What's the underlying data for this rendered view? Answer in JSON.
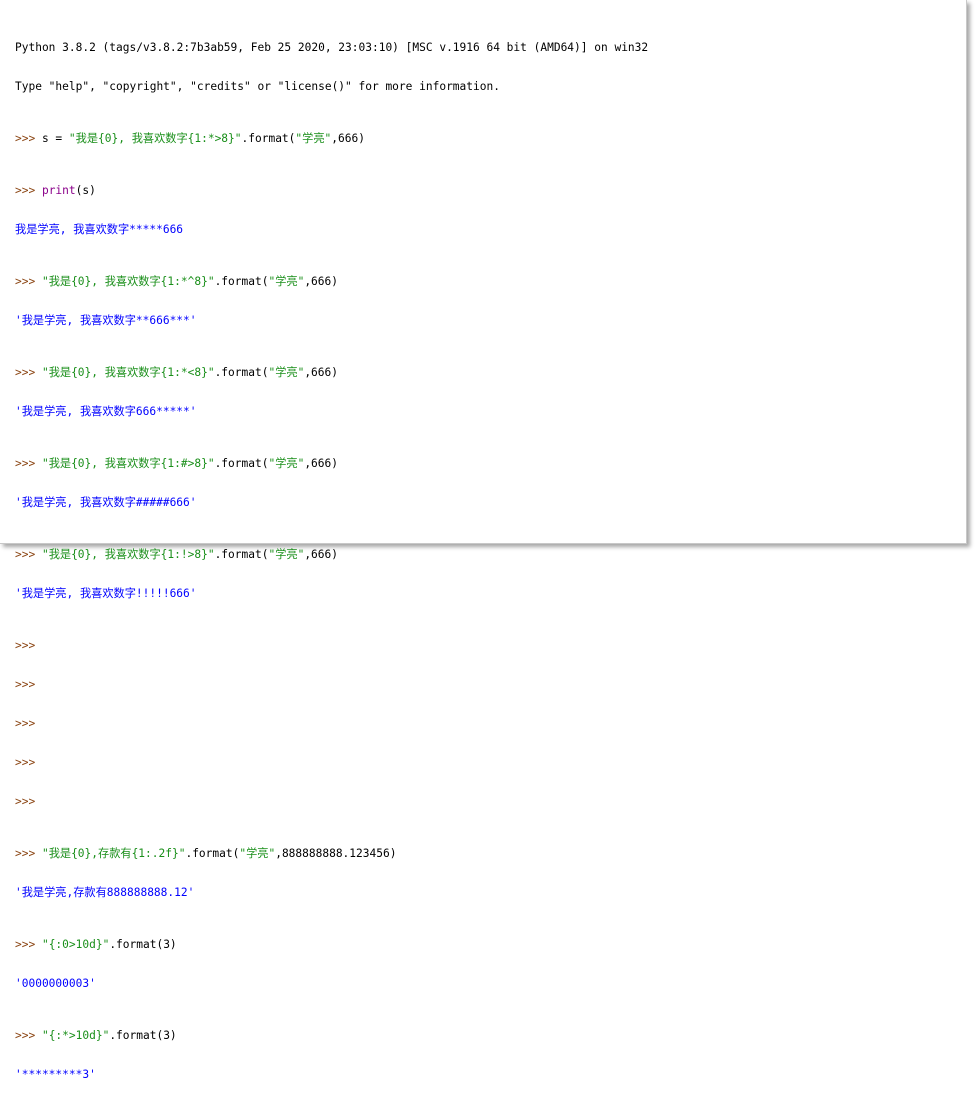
{
  "console": {
    "banner": [
      "Python 3.8.2 (tags/v3.8.2:7b3ab59, Feb 25 2020, 23:03:10) [MSC v.1916 64 bit (AMD64)] on win32",
      "Type \"help\", \"copyright\", \"credits\" or \"license()\" for more information."
    ],
    "prompt": ">>> ",
    "l1": {
      "a": "s = ",
      "b": "\"我是{0}, 我喜欢数字{1:*>8}\"",
      "c": ".format(",
      "d": "\"学亮\"",
      "e": ",666)"
    },
    "l2": {
      "kw": "print",
      "rest": "(s)"
    },
    "o2": "我是学亮, 我喜欢数字*****666",
    "l3": {
      "b": "\"我是{0}, 我喜欢数字{1:*^8}\"",
      "c": ".format(",
      "d": "\"学亮\"",
      "e": ",666)"
    },
    "o3": "'我是学亮, 我喜欢数字**666***'",
    "l4": {
      "b": "\"我是{0}, 我喜欢数字{1:*<8}\"",
      "c": ".format(",
      "d": "\"学亮\"",
      "e": ",666)"
    },
    "o4": "'我是学亮, 我喜欢数字666*****'",
    "l5": {
      "b": "\"我是{0}, 我喜欢数字{1:#>8}\"",
      "c": ".format(",
      "d": "\"学亮\"",
      "e": ",666)"
    },
    "o5": "'我是学亮, 我喜欢数字#####666'",
    "l6": {
      "b": "\"我是{0}, 我喜欢数字{1:!>8}\"",
      "c": ".format(",
      "d": "\"学亮\"",
      "e": ",666)"
    },
    "o6": "'我是学亮, 我喜欢数字!!!!!666'",
    "l7": {
      "b": "\"我是{0},存款有{1:.2f}\"",
      "c": ".format(",
      "d": "\"学亮\"",
      "e": ",888888888.123456)"
    },
    "o7": "'我是学亮,存款有888888888.12'",
    "l8": {
      "b": "\"{:0>10d}\"",
      "c": ".format(3)"
    },
    "o8": "'0000000003'",
    "l9": {
      "b": "\"{:*>10d}\"",
      "c": ".format(3)"
    },
    "o9": "'*********3'"
  },
  "colors": {
    "prompt": "#8b4513",
    "string": "#1a8f1a",
    "keyword": "#8a008a",
    "output": "#0000ff"
  }
}
